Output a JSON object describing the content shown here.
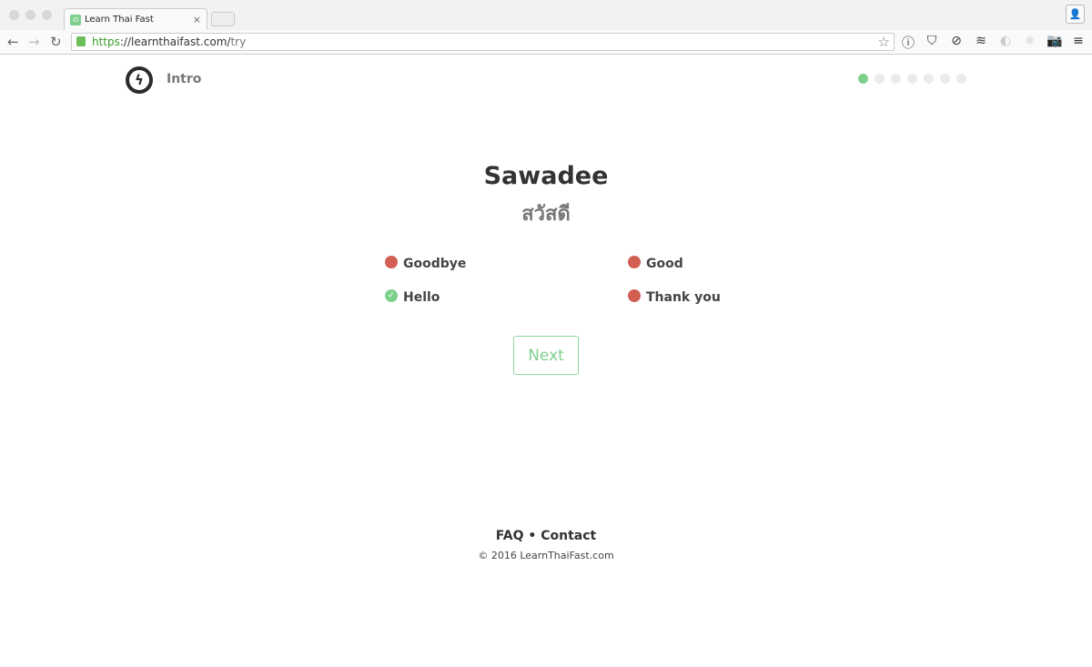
{
  "browser": {
    "tab_title": "Learn Thai Fast",
    "tab_close": "×",
    "url_scheme": "https",
    "url_host": "://learnthaifast.com/",
    "url_path": "try"
  },
  "header": {
    "section": "Intro",
    "progress": {
      "current": 1,
      "total": 7
    },
    "accent": "#7ed08c"
  },
  "question": {
    "word": "Sawadee",
    "thai": "สวัสดี"
  },
  "options": [
    {
      "label": "Goodbye",
      "state": "wrong"
    },
    {
      "label": "Good",
      "state": "wrong"
    },
    {
      "label": "Hello",
      "state": "correct"
    },
    {
      "label": "Thank you",
      "state": "wrong"
    }
  ],
  "colors": {
    "wrong": "#d35f52",
    "correct": "#7ed08c"
  },
  "next_label": "Next",
  "footer": {
    "faq": "FAQ",
    "sep": " • ",
    "contact": "Contact",
    "copyright": "© 2016 LearnThaiFast.com"
  }
}
